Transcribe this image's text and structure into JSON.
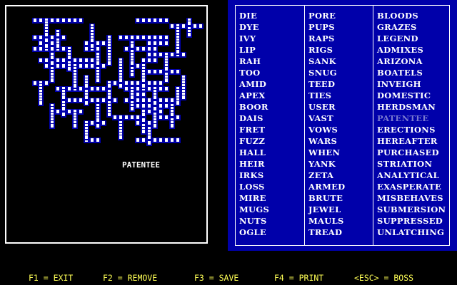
{
  "grid": {
    "placed_word": "PATENTEE"
  },
  "word_list": {
    "columns": [
      [
        "DIE",
        "DYE",
        "IVY",
        "LIP",
        "RAH",
        "TOO",
        "AMID",
        "APEX",
        "BOOR",
        "DAIS",
        "FRET",
        "FUZZ",
        "HALL",
        "HEIR",
        "IRKS",
        "LOSS",
        "MIRE",
        "MUGS",
        "NUTS",
        "OGLE"
      ],
      [
        "PORE",
        "PUPS",
        "RAPS",
        "RIGS",
        "SANK",
        "SNUG",
        "TEED",
        "TIES",
        "USER",
        "VAST",
        "VOWS",
        "WARS",
        "WHEN",
        "YANK",
        "ZETA",
        "ARMED",
        "BRUTE",
        "JEWEL",
        "MAULS",
        "TREAD"
      ],
      [
        "BLOODS",
        "GRAZES",
        "LEGEND",
        "ADMIXES",
        "ARIZONA",
        "BOATELS",
        "INVEIGH",
        "DOMESTIC",
        "HERDSMAN",
        "PATENTEE",
        "ERECTIONS",
        "HEREAFTER",
        "PURCHASED",
        "STRIATION",
        "ANALYTICAL",
        "EXASPERATE",
        "MISBEHAVES",
        "SUBMERSION",
        "SUPPRESSED",
        "UNLATCHING"
      ]
    ],
    "placed_words": [
      "PATENTEE"
    ]
  },
  "footer": {
    "f1": "F1 = EXIT",
    "f2": "F2 = REMOVE",
    "f3": "F3 = SAVE",
    "f4": "F4 = PRINT",
    "esc": "<ESC> = BOSS"
  },
  "colors": {
    "background": "#000000",
    "panel_blue": "#0000aa",
    "cell_fill": "#ffffff",
    "cell_shadow": "#0000aa",
    "footer_text": "#ffff55",
    "placed_word": "#7a7ad0"
  }
}
